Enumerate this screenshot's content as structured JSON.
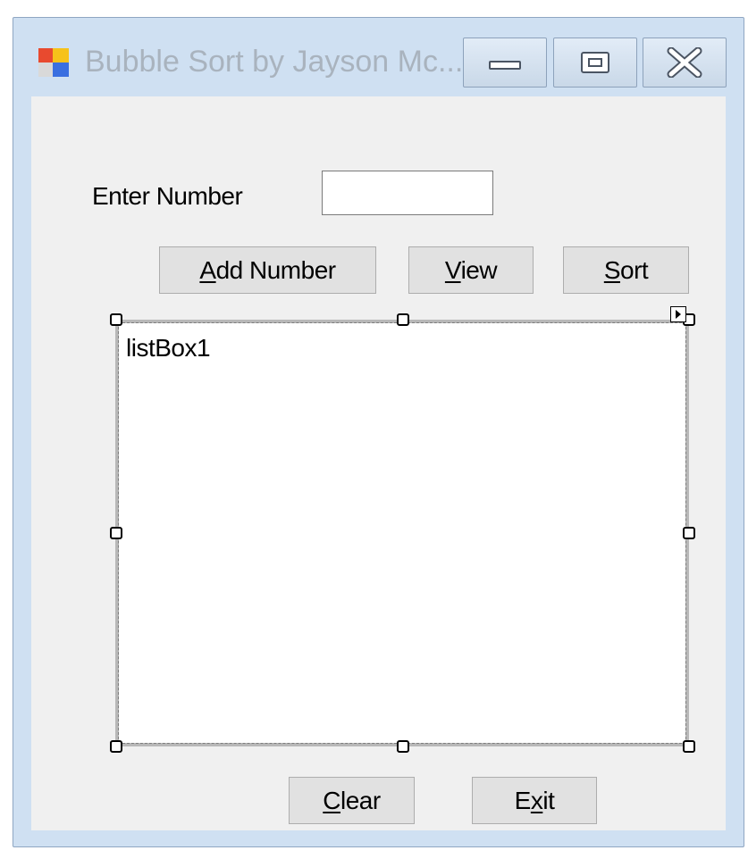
{
  "window": {
    "title": "Bubble Sort by Jayson Mc...",
    "icons": {
      "app": "app-form-icon",
      "minimize": "minimize-icon",
      "maximize": "maximize-icon",
      "close": "close-icon"
    }
  },
  "form": {
    "enter_label": "Enter Number",
    "input_value": "",
    "buttons": {
      "add_pre": "",
      "add_key": "A",
      "add_rest": "dd Number",
      "view_key": "V",
      "view_rest": "iew",
      "sort_key": "S",
      "sort_rest": "ort",
      "clear_key": "C",
      "clear_rest": "lear",
      "exit_pre": "E",
      "exit_key": "x",
      "exit_rest": "it"
    },
    "listbox": {
      "text": "listBox1"
    }
  }
}
